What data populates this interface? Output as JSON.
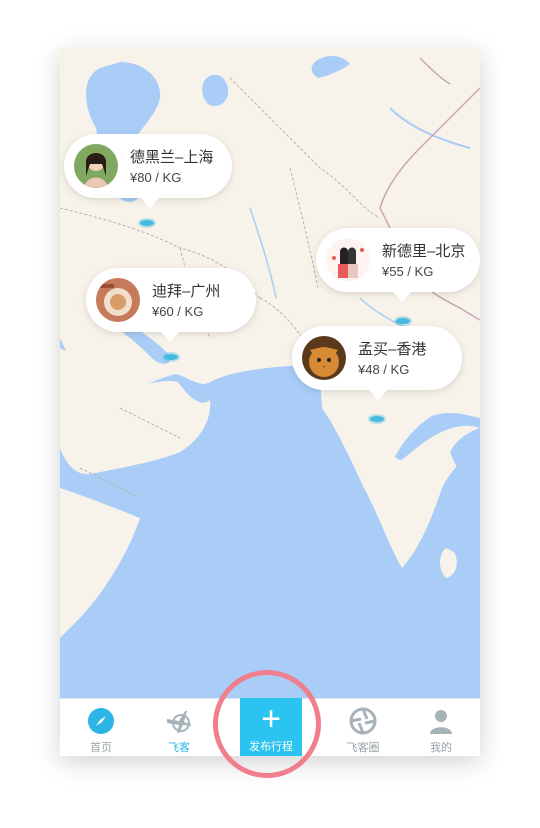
{
  "map": {
    "land_color": "#f7f3ea",
    "water_color": "#a9cdf7",
    "border_color": "#c9a4b6",
    "route_pins": [
      {
        "route": "德黑兰–上海",
        "price": "¥80 / KG",
        "avatar": "girl-portrait-avatar"
      },
      {
        "route": "迪拜–广州",
        "price": "¥60 / KG",
        "avatar": "food-bowl-avatar"
      },
      {
        "route": "新德里–北京",
        "price": "¥55 / KG",
        "avatar": "illustration-avatar"
      },
      {
        "route": "孟买–香港",
        "price": "¥48 / KG",
        "avatar": "cat-avatar"
      }
    ]
  },
  "tabbar": {
    "accent_color": "#2bc3ef",
    "tabs": [
      {
        "label": "首页",
        "icon": "compass-icon",
        "active": false
      },
      {
        "label": "飞客",
        "icon": "airplane-globe-icon",
        "active": true
      },
      {
        "label": "发布行程",
        "icon": "plus-icon",
        "active": false
      },
      {
        "label": "飞客圈",
        "icon": "aperture-icon",
        "active": false
      },
      {
        "label": "我的",
        "icon": "person-icon",
        "active": false
      }
    ]
  }
}
